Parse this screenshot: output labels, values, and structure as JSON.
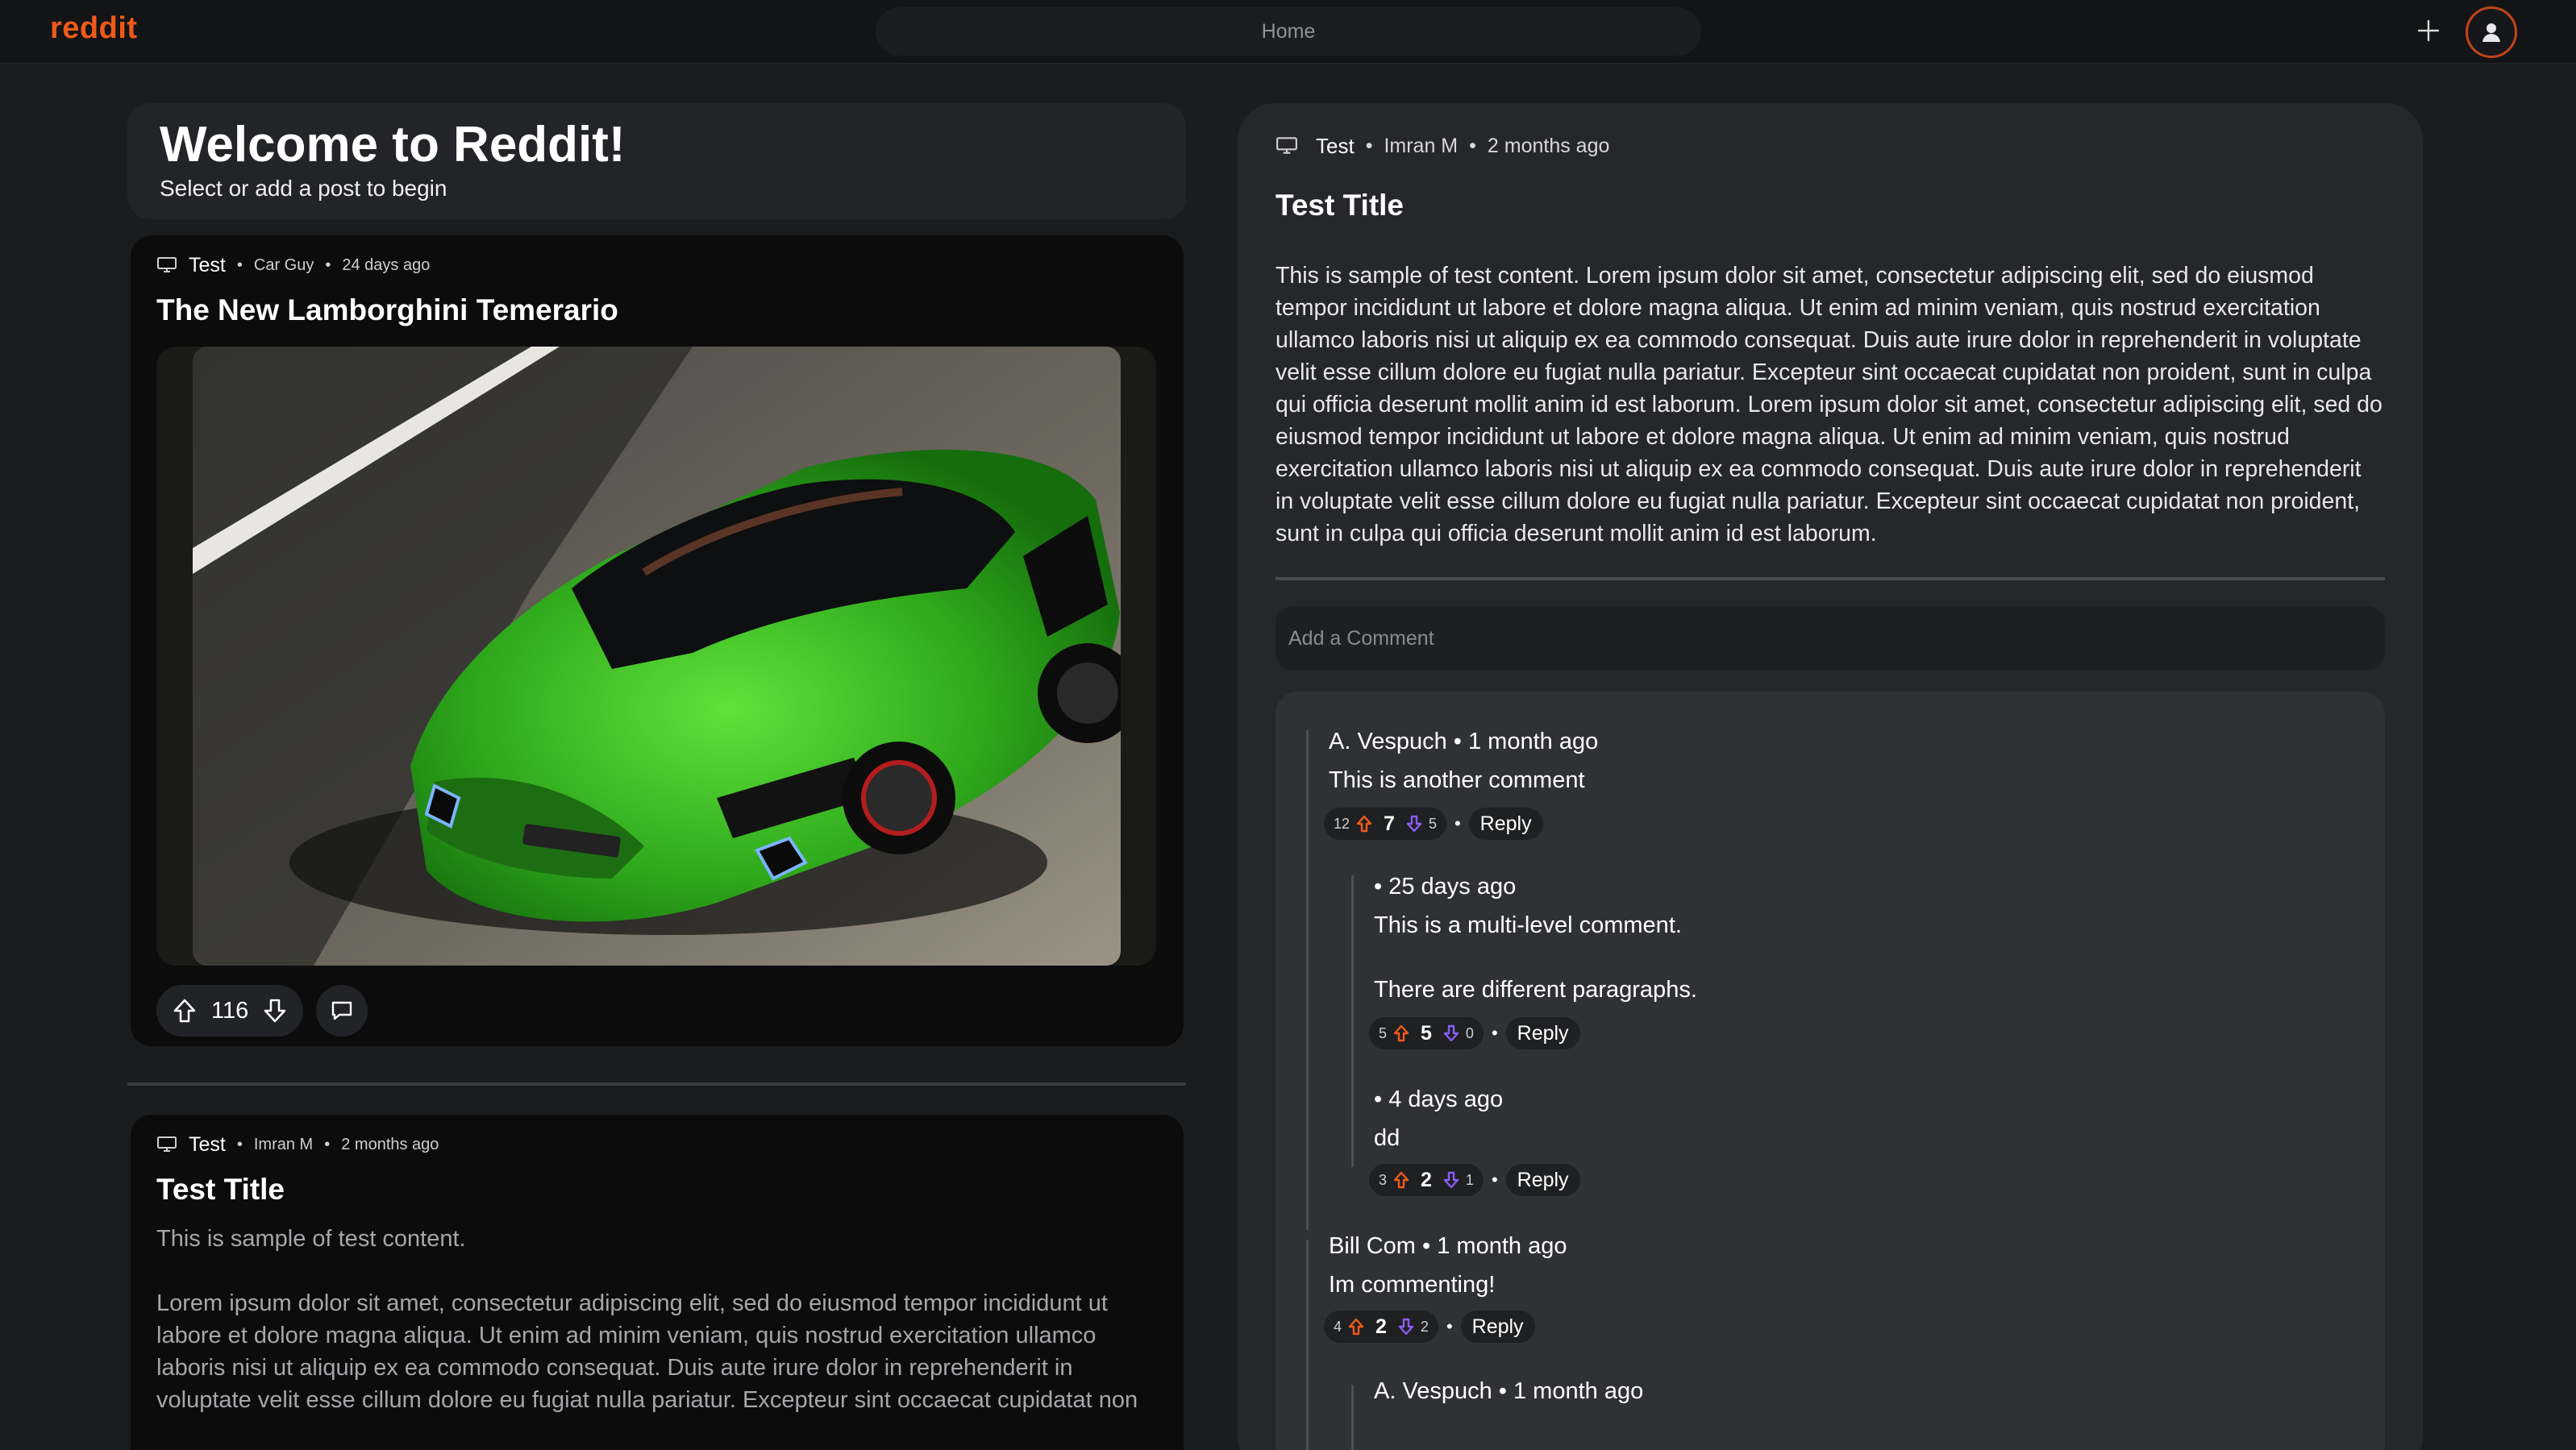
{
  "header": {
    "logo": "reddit",
    "search_text": "Home",
    "icons": {
      "create": "plus-icon",
      "profile": "user-icon"
    },
    "brand_color": "#f05a1a"
  },
  "welcome": {
    "title": "Welcome to Reddit!",
    "subtitle": "Select or add a post to begin"
  },
  "feed": {
    "posts": [
      {
        "community": "Test",
        "author": "Car Guy",
        "time": "24 days ago",
        "title": "The New Lamborghini Temerario",
        "image_alt": "Green Lamborghini Temerario",
        "score": "116"
      },
      {
        "community": "Test",
        "author": "Imran M",
        "time": "2 months ago",
        "title": "Test Title",
        "intro": "This is sample of test content.",
        "body": "Lorem ipsum dolor sit amet, consectetur adipiscing elit, sed do eiusmod tempor incididunt ut labore et dolore magna aliqua. Ut enim ad minim veniam, quis nostrud exercitation ullamco laboris nisi ut aliquip ex ea commodo consequat. Duis aute irure dolor in reprehenderit in voluptate velit esse cillum dolore eu fugiat nulla pariatur. Excepteur sint occaecat cupidatat non"
      }
    ]
  },
  "detail": {
    "community": "Test",
    "author": "Imran M",
    "time": "2 months ago",
    "title": "Test Title",
    "body": "This is sample of test content. Lorem ipsum dolor sit amet, consectetur adipiscing elit, sed do eiusmod tempor incididunt ut labore et dolore magna aliqua. Ut enim ad minim veniam, quis nostrud exercitation ullamco laboris nisi ut aliquip ex ea commodo consequat. Duis aute irure dolor in reprehenderit in voluptate velit esse cillum dolore eu fugiat nulla pariatur. Excepteur sint occaecat cupidatat non proident, sunt in culpa qui officia deserunt mollit anim id est laborum. Lorem ipsum dolor sit amet, consectetur adipiscing elit, sed do eiusmod tempor incididunt ut labore et dolore magna aliqua. Ut enim ad minim veniam, quis nostrud exercitation ullamco laboris nisi ut aliquip ex ea commodo consequat. Duis aute irure dolor in reprehenderit in voluptate velit esse cillum dolore eu fugiat nulla pariatur. Excepteur sint occaecat cupidatat non proident, sunt in culpa qui officia deserunt mollit anim id est laborum.",
    "comment_placeholder": "Add a Comment",
    "comments": [
      {
        "head": "A. Vespuch • 1 month ago",
        "text": "This is another comment",
        "up": "12",
        "score": "7",
        "down": "5",
        "reply": "Reply"
      },
      {
        "head": "• 25 days ago",
        "text": "This is a multi-level comment.",
        "text2": "There are different paragraphs.",
        "up": "5",
        "score": "5",
        "down": "0",
        "reply": "Reply"
      },
      {
        "head": "• 4 days ago",
        "text": "dd",
        "up": "3",
        "score": "2",
        "down": "1",
        "reply": "Reply"
      },
      {
        "head": "Bill Com • 1 month ago",
        "text": "Im commenting!",
        "up": "4",
        "score": "2",
        "down": "2",
        "reply": "Reply"
      },
      {
        "head": "A. Vespuch • 1 month ago"
      }
    ],
    "colors": {
      "upvote": "#f05a1a",
      "downvote": "#8b5cf6"
    }
  }
}
